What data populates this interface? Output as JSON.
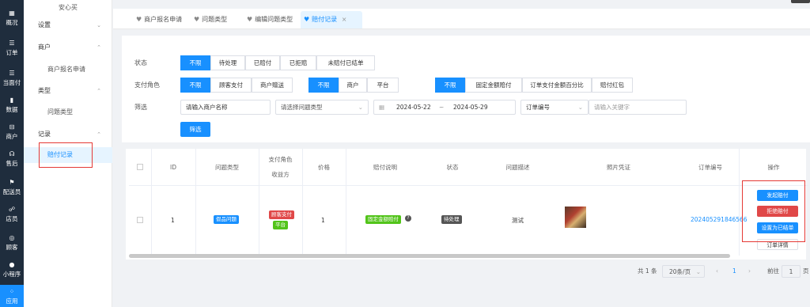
{
  "rail": [
    {
      "icon": "▦",
      "label": "概况"
    },
    {
      "icon": "☰",
      "label": "订单"
    },
    {
      "icon": "☰",
      "label": "当面付"
    },
    {
      "icon": "▮",
      "label": "数据"
    },
    {
      "icon": "⊟",
      "label": "商户"
    },
    {
      "icon": "☊",
      "label": "售后"
    },
    {
      "icon": "⚑",
      "label": "配送员"
    },
    {
      "icon": "☍",
      "label": "店员"
    },
    {
      "icon": "◎",
      "label": "顾客"
    },
    {
      "icon": "●",
      "label": "小程序"
    },
    {
      "icon": "⁘",
      "label": "应用"
    }
  ],
  "sidebar": {
    "app_name": "安心买",
    "items": [
      {
        "label": "设置",
        "type": "group",
        "chev": "⌄"
      },
      {
        "label": "商户",
        "type": "group",
        "chev": "⌃"
      },
      {
        "label": "商户报名申请",
        "type": "child"
      },
      {
        "label": "类型",
        "type": "group",
        "chev": "⌃"
      },
      {
        "label": "问题类型",
        "type": "child"
      },
      {
        "label": "记录",
        "type": "group",
        "chev": "⌃"
      },
      {
        "label": "赔付记录",
        "type": "child",
        "active": true
      }
    ]
  },
  "tabs": [
    {
      "label": "商户报名申请"
    },
    {
      "label": "问题类型"
    },
    {
      "label": "编辑问题类型"
    },
    {
      "label": "赔付记录",
      "active": true,
      "close": "×"
    }
  ],
  "filters": {
    "status_label": "状态",
    "status_options": [
      "不限",
      "待处理",
      "已赔付",
      "已拒赔",
      "未赔付已结单"
    ],
    "role_label": "支付角色",
    "role_options_a": [
      "不限",
      "顾客支付",
      "商户赠送"
    ],
    "role_options_b": [
      "不限",
      "商户",
      "平台"
    ],
    "role_options_c": [
      "不限",
      "固定金额赔付",
      "订单支付金额百分比",
      "赔付红包"
    ],
    "filter_label": "筛选",
    "merchant_placeholder": "请输入商户名称",
    "type_placeholder": "请选择问题类型",
    "date_start": "2024-05-22",
    "date_sep": "~",
    "date_end": "2024-05-29",
    "order_field": "订单编号",
    "keyword_placeholder": "请输入关键字",
    "submit": "筛选"
  },
  "table": {
    "headers": {
      "id": "ID",
      "type": "问题类型",
      "role_a": "支付角色",
      "role_b": "收益方",
      "price": "价格",
      "desc": "赔付说明",
      "status": "状态",
      "problem": "问题描述",
      "photo": "照片凭证",
      "order": "订单编号",
      "ops": "操作"
    },
    "row": {
      "id": "1",
      "type": "假品问题",
      "role_tag": "顾客支付",
      "beneficiary_tag": "平台",
      "price": "1",
      "desc_tag": "固定金额赔付",
      "status_tag": "待处理",
      "problem": "测试",
      "order_no": "202405291846566",
      "ops": [
        "发起赔付",
        "拒绝赔付",
        "设置为已结单",
        "订单详情"
      ]
    }
  },
  "pager": {
    "total": "共 1 条",
    "page_size": "20条/页",
    "prev": "‹",
    "current": "1",
    "next": "›",
    "goto_label": "前往",
    "goto_value": "1",
    "goto_unit": "页"
  },
  "colors": {
    "primary": "#1890ff",
    "danger": "#e04848",
    "success": "#52c41a",
    "dark_tag": "#555555",
    "rail": "#1f2d3d"
  }
}
